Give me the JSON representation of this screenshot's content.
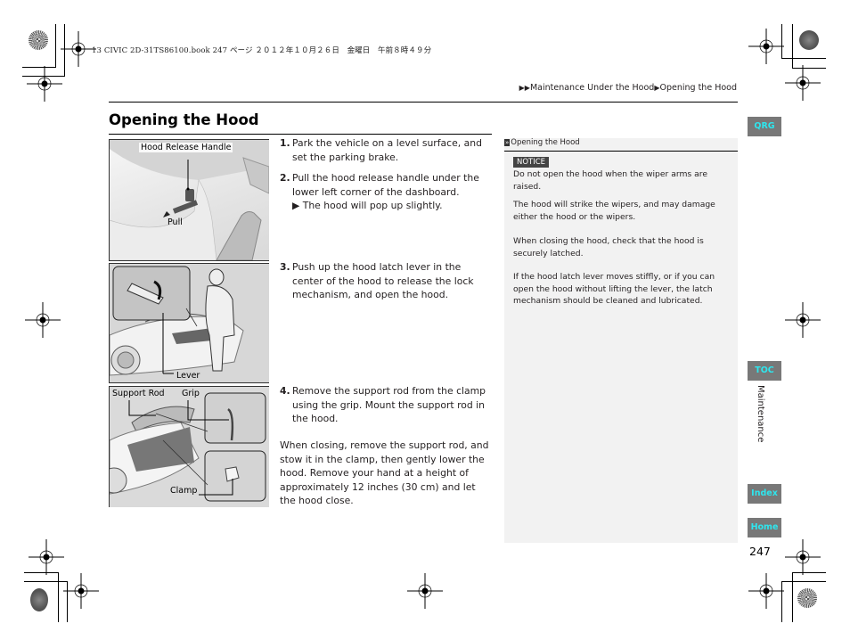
{
  "print_header": "13 CIVIC 2D-31TS86100.book  247 ページ  ２０１２年１０月２６日　金曜日　午前８時４９分",
  "breadcrumb": {
    "prefix_icon": "double-triangle-right-icon",
    "items": [
      "Maintenance Under the Hood",
      "Opening the Hood"
    ],
    "separator_icon": "triangle-right-icon"
  },
  "page_title": "Opening the Hood",
  "figures": [
    {
      "callouts": [
        "Hood Release Handle",
        "Pull"
      ]
    },
    {
      "callouts": [
        "Lever"
      ]
    },
    {
      "callouts": [
        "Support Rod",
        "Grip",
        "Clamp"
      ]
    }
  ],
  "steps": [
    {
      "num": "1.",
      "text": "Park the vehicle on a level surface, and set the parking brake."
    },
    {
      "num": "2.",
      "text": "Pull the hood release handle under the lower left corner of the dashboard.",
      "sub": "▶ The hood will pop up slightly."
    },
    {
      "num": "3.",
      "text": "Push up the hood latch lever in the center of the hood to release the lock mechanism, and open the hood."
    },
    {
      "num": "4.",
      "text": "Remove the support rod from the clamp using the grip. Mount the support rod in the hood."
    }
  ],
  "closing_paragraph": "When closing, remove the support rod, and stow it in the clamp, then gently lower the hood. Remove your hand at a height of approximately 12 inches (30 cm) and let the hood close.",
  "sidebar": {
    "header_icon": "double-chevron-icon",
    "header": "Opening the Hood",
    "notice_label": "NOTICE",
    "notice_text": "Do not open the hood when the wiper arms are raised.",
    "paragraphs": [
      "The hood will strike the wipers, and may damage either the hood or the wipers.",
      "When closing the hood, check that the hood is securely latched.",
      "If the hood latch lever moves stiffly, or if you can open the hood without lifting the lever, the latch mechanism should be cleaned and lubricated."
    ]
  },
  "nav_tabs": {
    "qrg": "QRG",
    "toc": "TOC",
    "index": "Index",
    "home": "Home"
  },
  "section_label": "Maintenance",
  "page_number": "247",
  "colors": {
    "tab_bg": "#787878",
    "tab_text": "#2ee6ee",
    "sidebar_bg": "#f2f2f2",
    "notice_bg": "#444444"
  }
}
